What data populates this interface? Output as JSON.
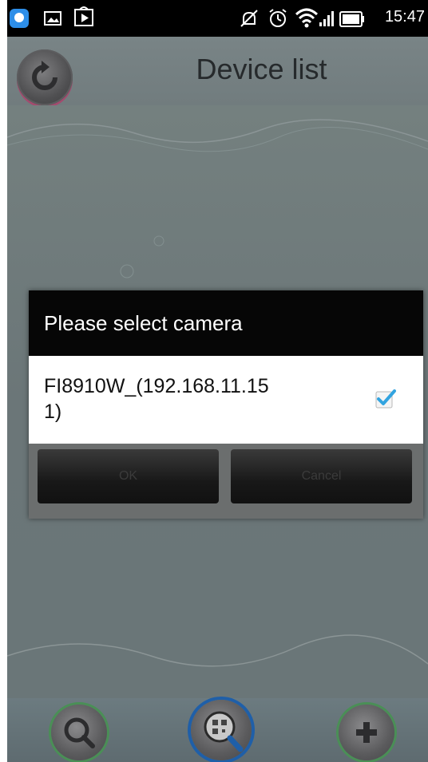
{
  "status_bar": {
    "time": "15:47",
    "icons": [
      "app-notification-icon",
      "image-icon",
      "play-store-icon",
      "mute-icon",
      "alarm-icon",
      "wifi-icon",
      "signal-icon",
      "battery-icon"
    ]
  },
  "header": {
    "title": "Device list",
    "refresh_icon": "refresh-icon"
  },
  "dialog": {
    "title": "Please select camera",
    "items": [
      {
        "label": "FI8910W_(192.168.11.151)",
        "checked": true
      }
    ],
    "ok_label": "OK",
    "cancel_label": "Cancel"
  },
  "bottom_bar": {
    "buttons": [
      "search-icon",
      "qr-scan-icon",
      "add-icon"
    ]
  },
  "colors": {
    "background": "#6f7a7c",
    "dialog_title_bg": "#060606",
    "check_accent": "#33a4e0"
  }
}
